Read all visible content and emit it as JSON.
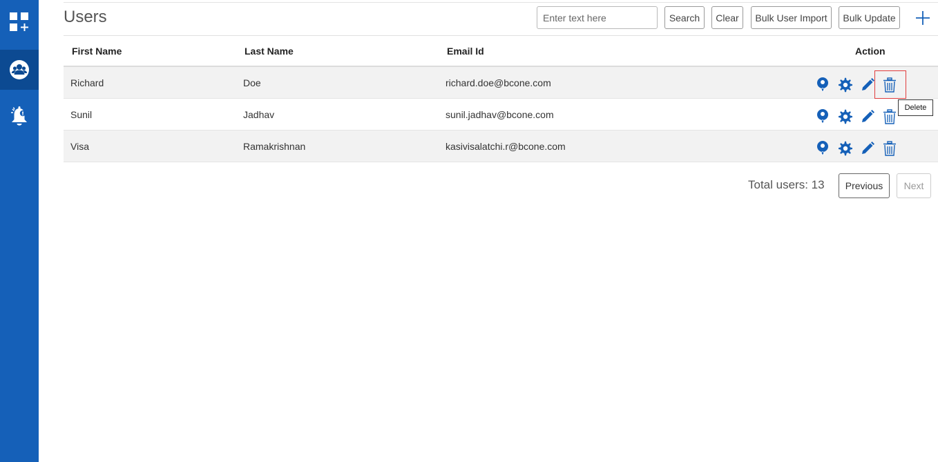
{
  "colors": {
    "sidebar": "#1560b8",
    "sidebar_active": "#0c4a92",
    "icon_blue": "#1560b8",
    "focus_red": "#e03c3c"
  },
  "sidebar": {
    "items": [
      {
        "icon": "dashboard-add-icon",
        "active": false
      },
      {
        "icon": "users-group-icon",
        "active": true
      },
      {
        "icon": "notification-bell-icon",
        "active": false
      }
    ]
  },
  "header": {
    "title": "Users",
    "search_placeholder": "Enter text here",
    "search_label": "Search",
    "clear_label": "Clear",
    "bulk_import_label": "Bulk User Import",
    "bulk_update_label": "Bulk Update",
    "add_icon": "plus-icon"
  },
  "table": {
    "columns": {
      "first_name": "First Name",
      "last_name": "Last Name",
      "email": "Email Id",
      "action": "Action"
    },
    "rows": [
      {
        "first_name": "Richard",
        "last_name": "Doe",
        "email": "richard.doe@bcone.com"
      },
      {
        "first_name": "Sunil",
        "last_name": "Jadhav",
        "email": "sunil.jadhav@bcone.com"
      },
      {
        "first_name": "Visa",
        "last_name": "Ramakrishnan",
        "email": "kasivisalatchi.r@bcone.com"
      }
    ],
    "action_icons": [
      "role-badge-icon",
      "settings-gear-icon",
      "edit-pencil-icon",
      "delete-trash-icon"
    ]
  },
  "tooltip": "Delete",
  "pagination": {
    "total_text": "Total users: 13",
    "previous_label": "Previous",
    "next_label": "Next"
  }
}
